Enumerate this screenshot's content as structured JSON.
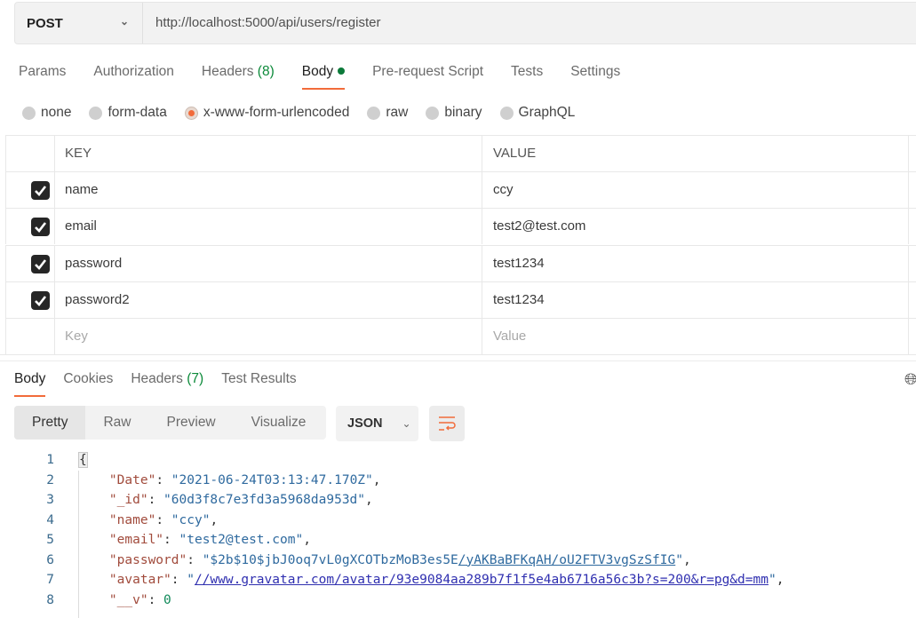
{
  "request": {
    "method": "POST",
    "url": "http://localhost:5000/api/users/register"
  },
  "request_tabs": [
    {
      "label": "Params"
    },
    {
      "label": "Authorization"
    },
    {
      "label": "Headers",
      "count": "(8)"
    },
    {
      "label": "Body",
      "active": true,
      "indicator": "green-dot"
    },
    {
      "label": "Pre-request Script"
    },
    {
      "label": "Tests"
    },
    {
      "label": "Settings"
    }
  ],
  "body_types": [
    {
      "label": "none"
    },
    {
      "label": "form-data"
    },
    {
      "label": "x-www-form-urlencoded",
      "selected": true
    },
    {
      "label": "raw"
    },
    {
      "label": "binary"
    },
    {
      "label": "GraphQL"
    }
  ],
  "params_table": {
    "headers": {
      "key": "KEY",
      "value": "VALUE"
    },
    "rows": [
      {
        "checked": true,
        "key": "name",
        "value": "ccy"
      },
      {
        "checked": true,
        "key": "email",
        "value": "test2@test.com"
      },
      {
        "checked": true,
        "key": "password",
        "value": "test1234"
      },
      {
        "checked": true,
        "key": "password2",
        "value": "test1234"
      }
    ],
    "placeholder": {
      "key": "Key",
      "value": "Value"
    }
  },
  "response_tabs": [
    {
      "label": "Body",
      "active": true
    },
    {
      "label": "Cookies"
    },
    {
      "label": "Headers",
      "count": "(7)"
    },
    {
      "label": "Test Results"
    }
  ],
  "view_modes": [
    {
      "label": "Pretty",
      "active": true
    },
    {
      "label": "Raw"
    },
    {
      "label": "Preview"
    },
    {
      "label": "Visualize"
    }
  ],
  "format": "JSON",
  "icons": {
    "wrap": "wrap-lines-icon",
    "globe": "globe-icon"
  },
  "colors": {
    "accent": "#f26b3a",
    "count_green": "#0c8a3a"
  },
  "response_json": {
    "open": "{",
    "lines": [
      {
        "key": "\"Date\"",
        "value": "\"2021-06-24T03:13:47.170Z\"",
        "comma": ","
      },
      {
        "key": "\"_id\"",
        "value": "\"60d3f8c7e3fd3a5968da953d\"",
        "comma": ","
      },
      {
        "key": "\"name\"",
        "value": "\"ccy\"",
        "comma": ","
      },
      {
        "key": "\"email\"",
        "value": "\"test2@test.com\"",
        "comma": ","
      },
      {
        "key": "\"password\"",
        "value": "\"$2b$10$jbJ0oq7vL0gXCOTbzMoB3es5E",
        "link": "/yAKBaBFKqAH/oU2FTV3vgSzSfIG",
        "tail": "\"",
        "comma": ","
      },
      {
        "key": "\"avatar\"",
        "value": "\"",
        "link": "//www.gravatar.com/avatar/93e9084aa289b7f1f5e4ab6716a56c3b?s=200&r=pg&d=mm",
        "tail": "\"",
        "comma": ",",
        "link2": true
      },
      {
        "key": "\"__v\"",
        "number": "0",
        "comma": ""
      }
    ]
  }
}
